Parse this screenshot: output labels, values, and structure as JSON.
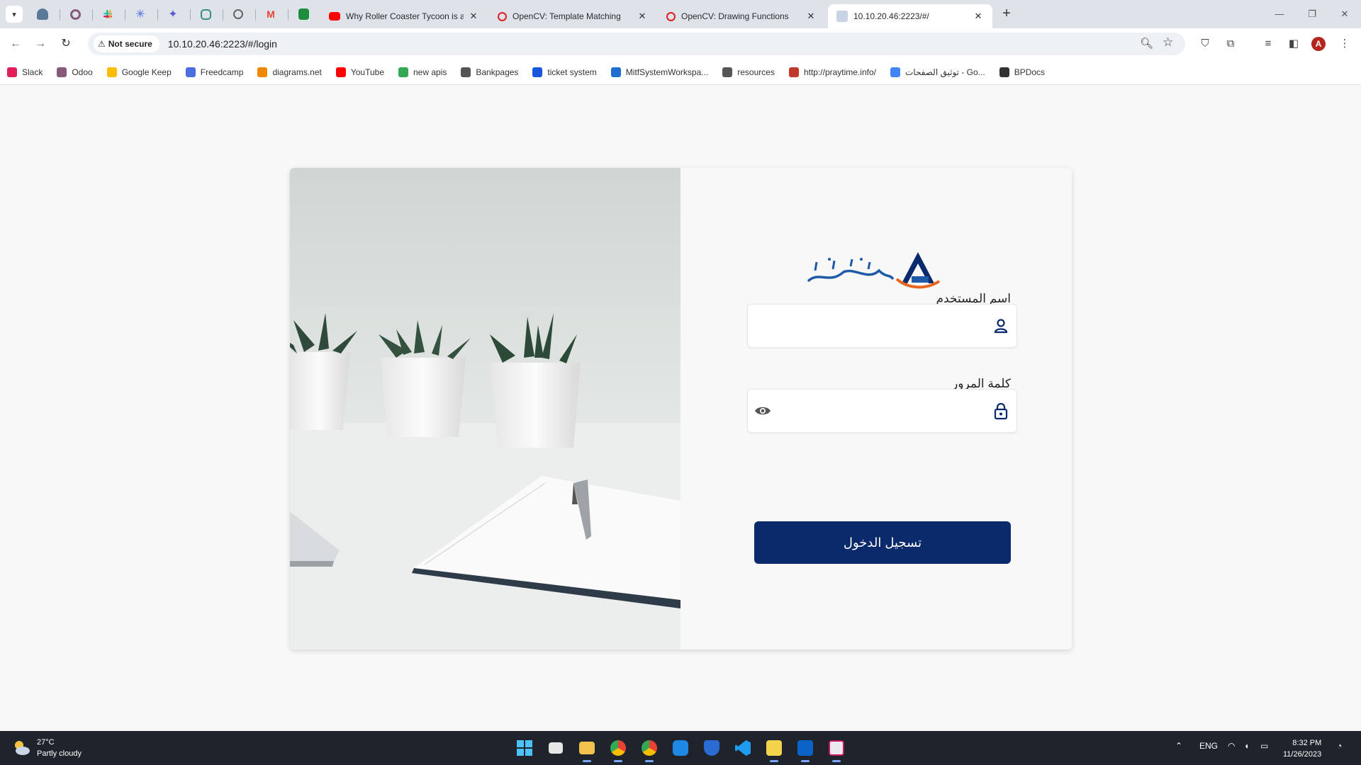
{
  "browser": {
    "tabs": [
      {
        "title": "Why Roller Coaster Tycoon is a"
      },
      {
        "title": "OpenCV: Template Matching"
      },
      {
        "title": "OpenCV: Drawing Functions"
      },
      {
        "title": "10.10.20.46:2223/#/"
      }
    ],
    "security_label": "Not secure",
    "url": "10.10.20.46:2223/#/login",
    "profile_initial": "A",
    "bookmarks": [
      {
        "label": "Slack",
        "color": "#e01e5a"
      },
      {
        "label": "Odoo",
        "color": "#875a7b"
      },
      {
        "label": "Google Keep",
        "color": "#fbbc04"
      },
      {
        "label": "Freedcamp",
        "color": "#4a6ee0"
      },
      {
        "label": "diagrams.net",
        "color": "#f08705"
      },
      {
        "label": "YouTube",
        "color": "#ff0000"
      },
      {
        "label": "new apis",
        "color": "#34a853"
      },
      {
        "label": "Bankpages",
        "color": "#555555"
      },
      {
        "label": "ticket system",
        "color": "#1a56db"
      },
      {
        "label": "MitfSystemWorkspa...",
        "color": "#1f6fd1"
      },
      {
        "label": "resources",
        "color": "#555555"
      },
      {
        "label": "http://praytime.info/",
        "color": "#c0392b"
      },
      {
        "label": "توثيق الصفحات - Go...",
        "color": "#4285f4"
      },
      {
        "label": "BPDocs",
        "color": "#333333"
      }
    ]
  },
  "login": {
    "username_label": "اسم المستخدم",
    "password_label": "كلمة المرور",
    "submit_label": "تسجيل الدخول",
    "username_value": "",
    "password_value": "",
    "accent_color": "#0b2a6b"
  },
  "taskbar": {
    "temperature": "27°C",
    "weather": "Partly cloudy",
    "language": "ENG",
    "time": "8:32 PM",
    "date": "11/26/2023"
  }
}
